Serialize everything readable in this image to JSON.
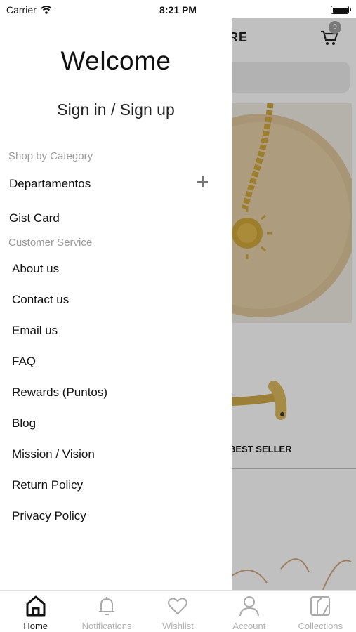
{
  "status_bar": {
    "carrier": "Carrier",
    "time": "8:21 PM"
  },
  "background": {
    "brand_partial": "RE",
    "cart_count": "0",
    "product_caption": "BEST SELLER"
  },
  "drawer": {
    "welcome": "Welcome",
    "signin": "Sign in / Sign up",
    "shop_label": "Shop by Category",
    "departments": "Departamentos",
    "gift_card": "Gist Card",
    "customer_label": "Customer Service",
    "items": [
      {
        "label": "About us"
      },
      {
        "label": "Contact us"
      },
      {
        "label": "Email us"
      },
      {
        "label": "FAQ"
      },
      {
        "label": "Rewards (Puntos)"
      },
      {
        "label": "Blog"
      },
      {
        "label": "Mission / Vision"
      },
      {
        "label": "Return Policy"
      },
      {
        "label": "Privacy Policy"
      }
    ]
  },
  "tabs": [
    {
      "label": "Home",
      "icon": "home-icon",
      "active": true
    },
    {
      "label": "Notifications",
      "icon": "bell-icon",
      "active": false
    },
    {
      "label": "Wishlist",
      "icon": "heart-icon",
      "active": false
    },
    {
      "label": "Account",
      "icon": "person-icon",
      "active": false
    },
    {
      "label": "Collections",
      "icon": "collections-icon",
      "active": false
    }
  ]
}
